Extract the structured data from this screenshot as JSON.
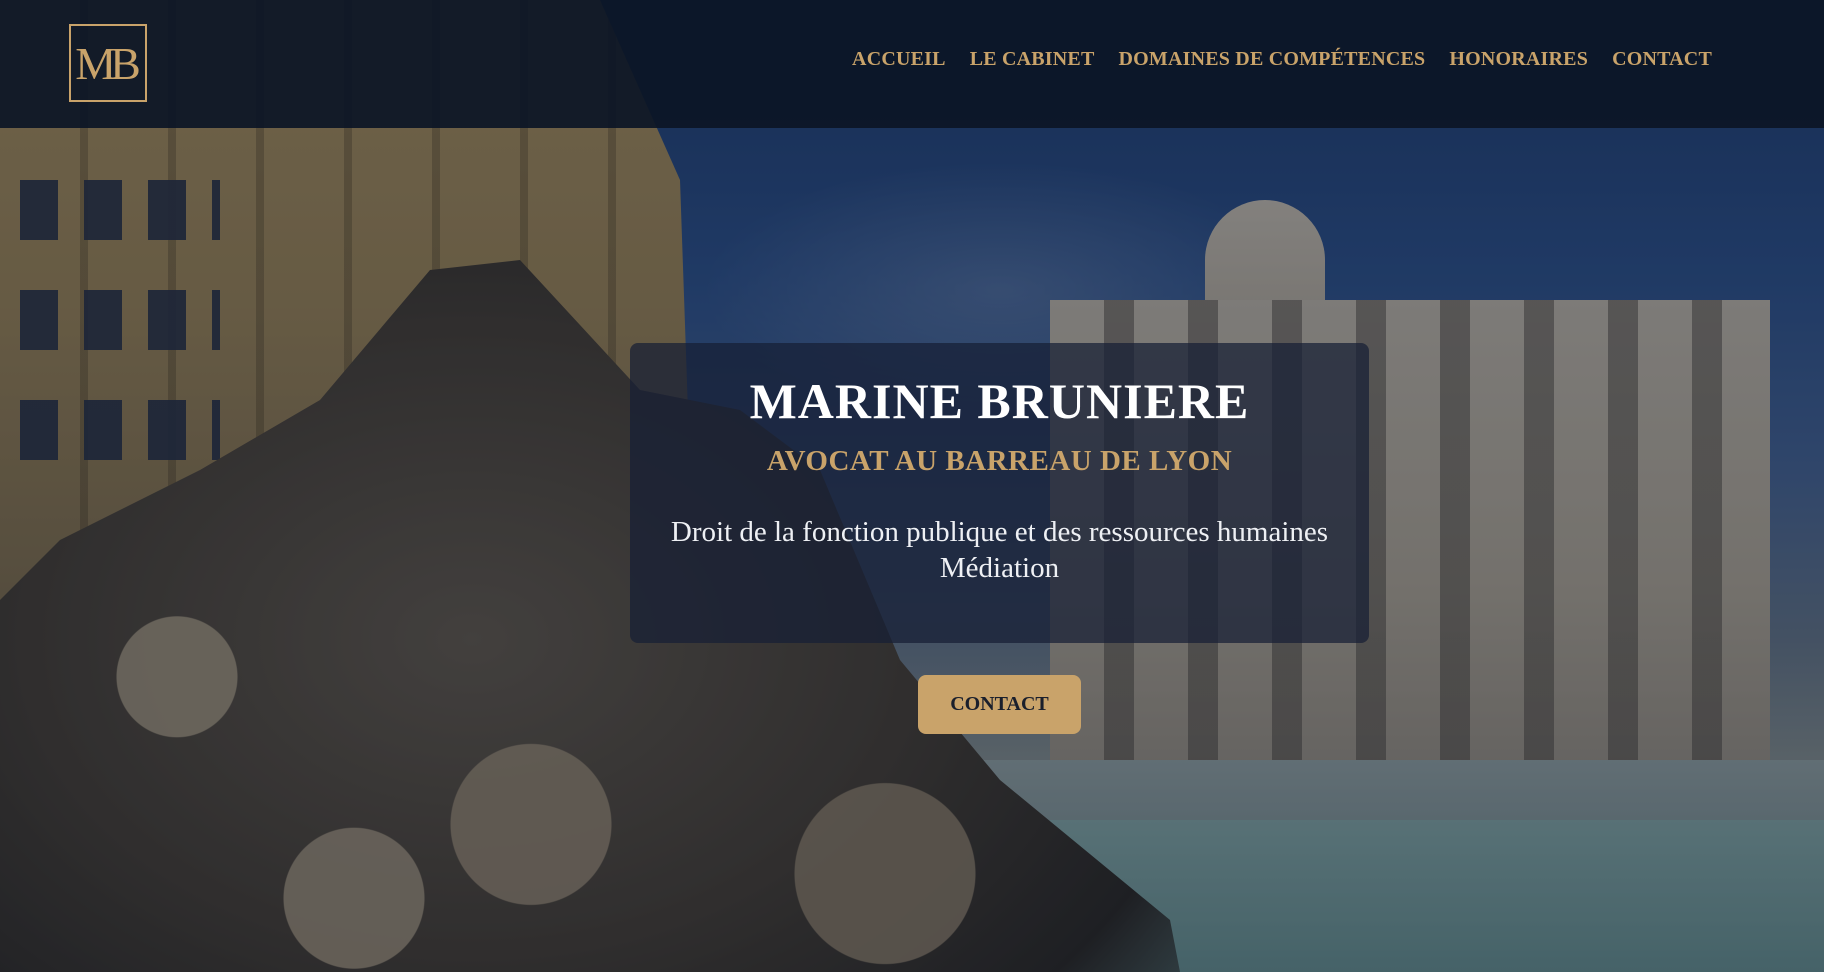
{
  "header": {
    "logo_text": "MB",
    "nav": [
      {
        "label": "ACCUEIL"
      },
      {
        "label": "LE CABINET"
      },
      {
        "label": "DOMAINES DE COMPÉTENCES"
      },
      {
        "label": "HONORAIRES"
      },
      {
        "label": "CONTACT"
      }
    ]
  },
  "hero": {
    "name": "MARINE BRUNIERE",
    "title": "AVOCAT AU BARREAU DE LYON",
    "specialties": [
      "Droit de la fonction publique et des ressources humaines",
      "Médiation"
    ],
    "cta_label": "CONTACT"
  },
  "colors": {
    "accent": "#c9a36a",
    "navbar": "#0c1626",
    "card": "#161e34"
  }
}
